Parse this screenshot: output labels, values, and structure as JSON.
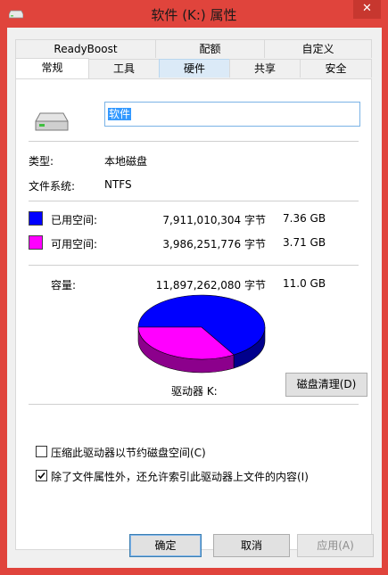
{
  "window": {
    "title": "软件 (K:) 属性",
    "close_symbol": "✕"
  },
  "tabs_row1": [
    {
      "label": "ReadyBoost"
    },
    {
      "label": "配额"
    },
    {
      "label": "自定义"
    }
  ],
  "tabs_row2": [
    {
      "label": "常规"
    },
    {
      "label": "工具"
    },
    {
      "label": "硬件"
    },
    {
      "label": "共享"
    },
    {
      "label": "安全"
    }
  ],
  "general": {
    "drive_name": "软件",
    "type_label": "类型:",
    "type_value": "本地磁盘",
    "fs_label": "文件系统:",
    "fs_value": "NTFS",
    "used": {
      "label": "已用空间:",
      "bytes": "7,911,010,304 字节",
      "size": "7.36 GB",
      "color": "#0000ff"
    },
    "free": {
      "label": "可用空间:",
      "bytes": "3,986,251,776 字节",
      "size": "3.71 GB",
      "color": "#ff00ff"
    },
    "capacity": {
      "label": "容量:",
      "bytes": "11,897,262,080 字节",
      "size": "11.0 GB"
    },
    "drive_label": "驱动器 K:",
    "cleanup_button": "磁盘清理(D)",
    "compress_checkbox": {
      "label": "压缩此驱动器以节约磁盘空间(C)",
      "checked": false
    },
    "index_checkbox": {
      "label": "除了文件属性外，还允许索引此驱动器上文件的内容(I)",
      "checked": true
    }
  },
  "buttons": {
    "ok": "确定",
    "cancel": "取消",
    "apply": "应用(A)"
  },
  "chart_data": {
    "type": "pie",
    "categories": [
      "已用空间",
      "可用空间"
    ],
    "values": [
      7911010304,
      3986251776
    ],
    "colors": [
      "#0000ff",
      "#ff00ff"
    ]
  }
}
